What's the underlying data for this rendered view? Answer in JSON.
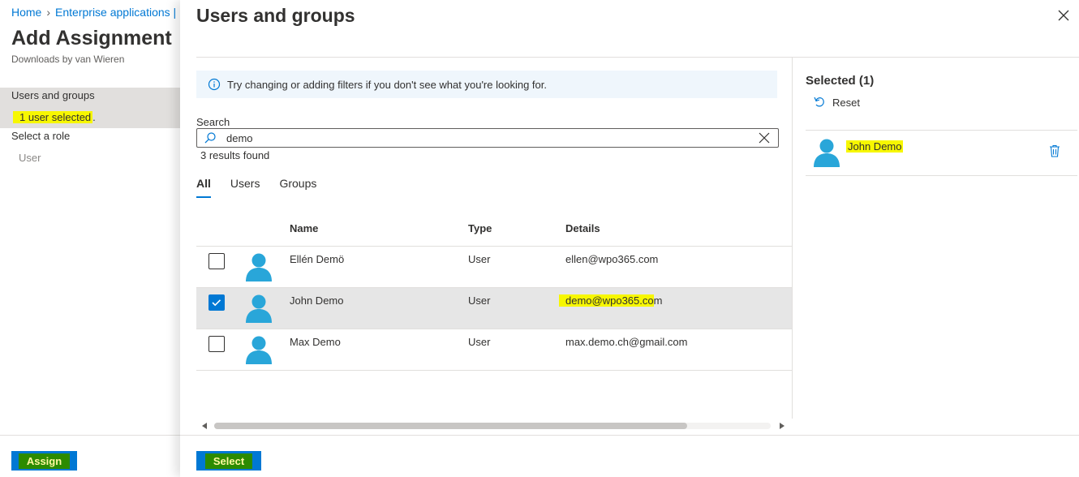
{
  "background": {
    "breadcrumb": [
      "Home",
      "Enterprise applications |"
    ],
    "title": "Add Assignment",
    "subtitle": "Downloads by van Wieren",
    "users_groups_label": "Users and groups",
    "users_selected": "1 user selected",
    "users_selected_suffix": ".",
    "role_label": "Select a role",
    "role_value": "User",
    "assign_label": "Assign"
  },
  "panel": {
    "title": "Users and groups",
    "info_text": "Try changing or adding filters if you don't see what you're looking for.",
    "search_label": "Search",
    "search_value": "demo",
    "results_text": "3 results found",
    "tabs": [
      "All",
      "Users",
      "Groups"
    ],
    "active_tab": "All",
    "columns": {
      "name": "Name",
      "type": "Type",
      "details": "Details"
    },
    "rows": [
      {
        "name": "Ellén Demö",
        "type": "User",
        "details": "ellen@wpo365.com",
        "checked": false
      },
      {
        "name": "John Demo",
        "type": "User",
        "details_highlight": "demo@wpo365.co",
        "details_rest": "m",
        "checked": true
      },
      {
        "name": "Max Demo",
        "type": "User",
        "details": "max.demo.ch@gmail.com",
        "checked": false
      }
    ],
    "horizontal_scroll_fraction": 0.85,
    "select_label": "Select"
  },
  "selected_pane": {
    "title": "Selected (1)",
    "reset_label": "Reset",
    "items": [
      {
        "name": "John Demo"
      }
    ]
  },
  "colors": {
    "accent": "#0078d4",
    "highlight": "#f7f700",
    "button_highlight_bg": "#2c8b00",
    "avatar": "#29a6d9"
  },
  "icons": [
    "info-icon",
    "search-icon",
    "clear-icon",
    "close-icon",
    "user-avatar-icon",
    "reset-icon",
    "delete-icon",
    "checkmark-icon"
  ]
}
